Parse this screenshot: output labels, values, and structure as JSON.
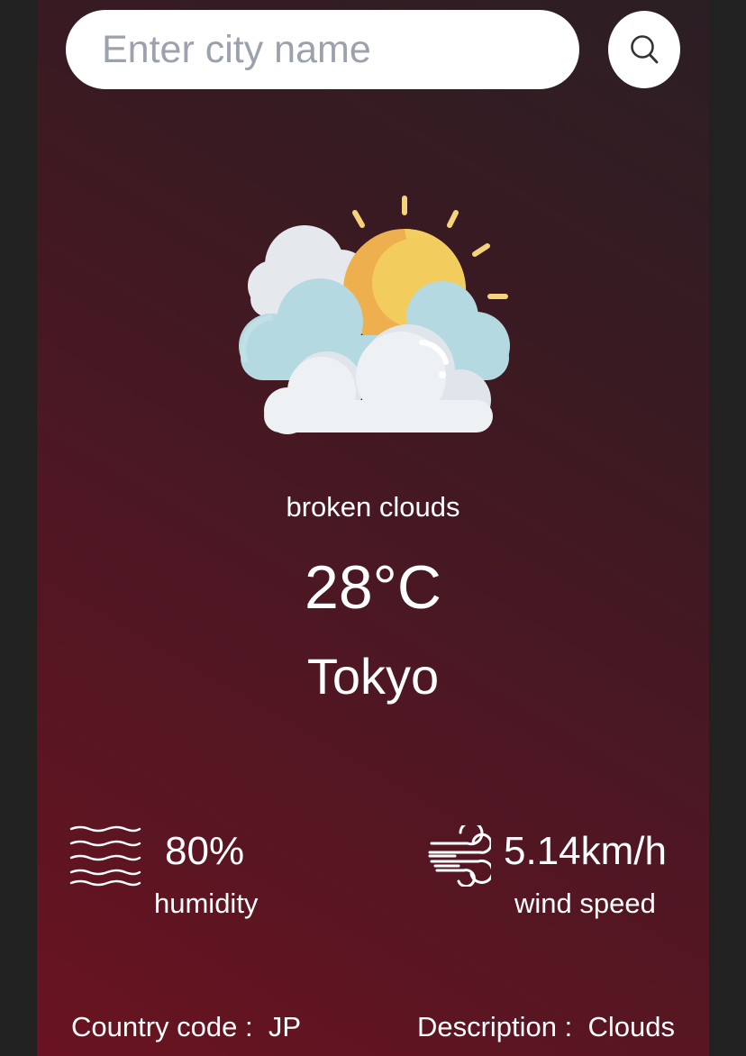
{
  "search": {
    "placeholder": "Enter city name",
    "value": "",
    "button_icon": "search-icon"
  },
  "weather": {
    "icon": "partly-cloudy-icon",
    "description": "broken clouds",
    "temperature": "28°C",
    "city": "Tokyo"
  },
  "stats": {
    "humidity": {
      "icon": "humidity-icon",
      "value": "80%",
      "label": "humidity"
    },
    "wind": {
      "icon": "wind-icon",
      "value": "5.14km/h",
      "label": "wind speed"
    }
  },
  "footer": {
    "country_label": "Country code :",
    "country_value": "JP",
    "description_label": "Description :",
    "description_value": "Clouds"
  },
  "colors": {
    "page_background": "#212121",
    "card_gradient_start": "#6a1320",
    "card_gradient_end": "#2b1f24",
    "text": "#ffffff"
  }
}
